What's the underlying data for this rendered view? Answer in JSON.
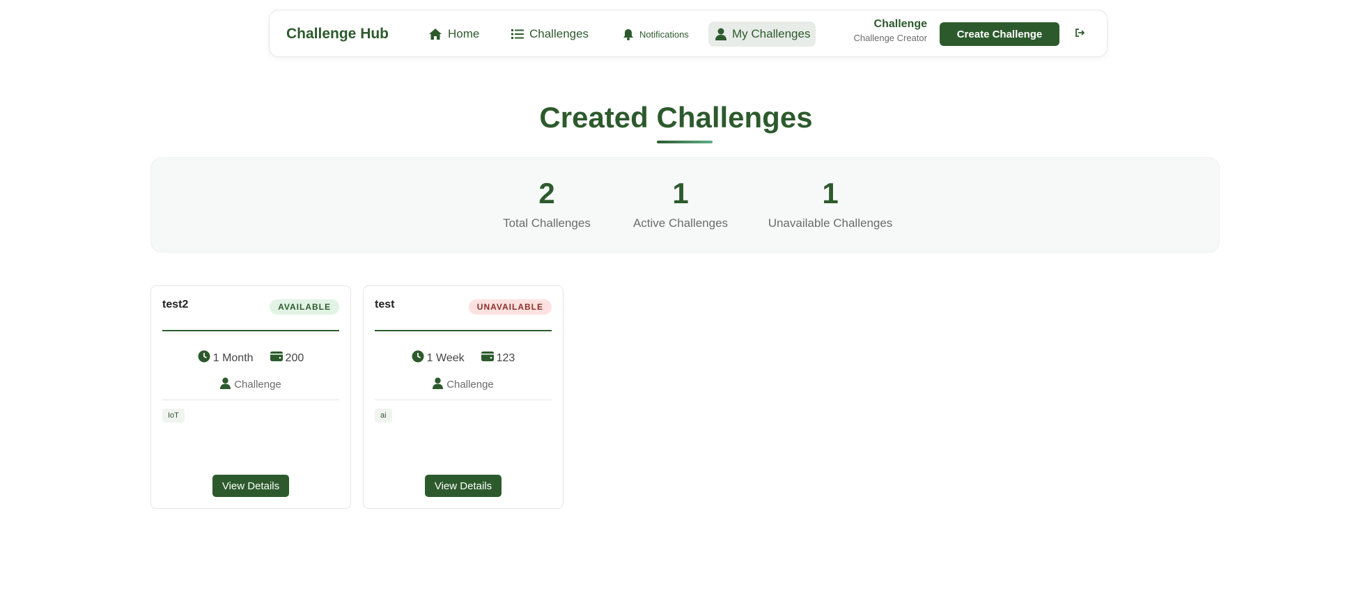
{
  "nav": {
    "brand": "Challenge Hub",
    "links": [
      {
        "label": "Home",
        "icon": "home-icon"
      },
      {
        "label": "Challenges",
        "icon": "list-icon"
      },
      {
        "label": "Notifications",
        "icon": "bell-icon"
      },
      {
        "label": "My Challenges",
        "icon": "user-icon",
        "active": true
      }
    ],
    "user_name": "Challenge",
    "user_role": "Challenge Creator",
    "create_label": "Create Challenge",
    "logout_icon": "logout-icon"
  },
  "page": {
    "title": "Created Challenges"
  },
  "stats": [
    {
      "value": "2",
      "label": "Total Challenges"
    },
    {
      "value": "1",
      "label": "Active Challenges"
    },
    {
      "value": "1",
      "label": "Unavailable Challenges"
    }
  ],
  "cards": [
    {
      "title": "test2",
      "status": "AVAILABLE",
      "duration": "1 Month",
      "reward": "200",
      "creator": "Challenge",
      "tag": "IoT",
      "button": "View Details"
    },
    {
      "title": "test",
      "status": "UNAVAILABLE",
      "duration": "1 Week",
      "reward": "123",
      "creator": "Challenge",
      "tag": "ai",
      "button": "View Details"
    }
  ],
  "colors": {
    "primary": "#2d5a2d",
    "available_bg": "#e2f3e5",
    "unavailable_bg": "#fbe2e0",
    "unavailable_text": "#8a2f2a"
  }
}
